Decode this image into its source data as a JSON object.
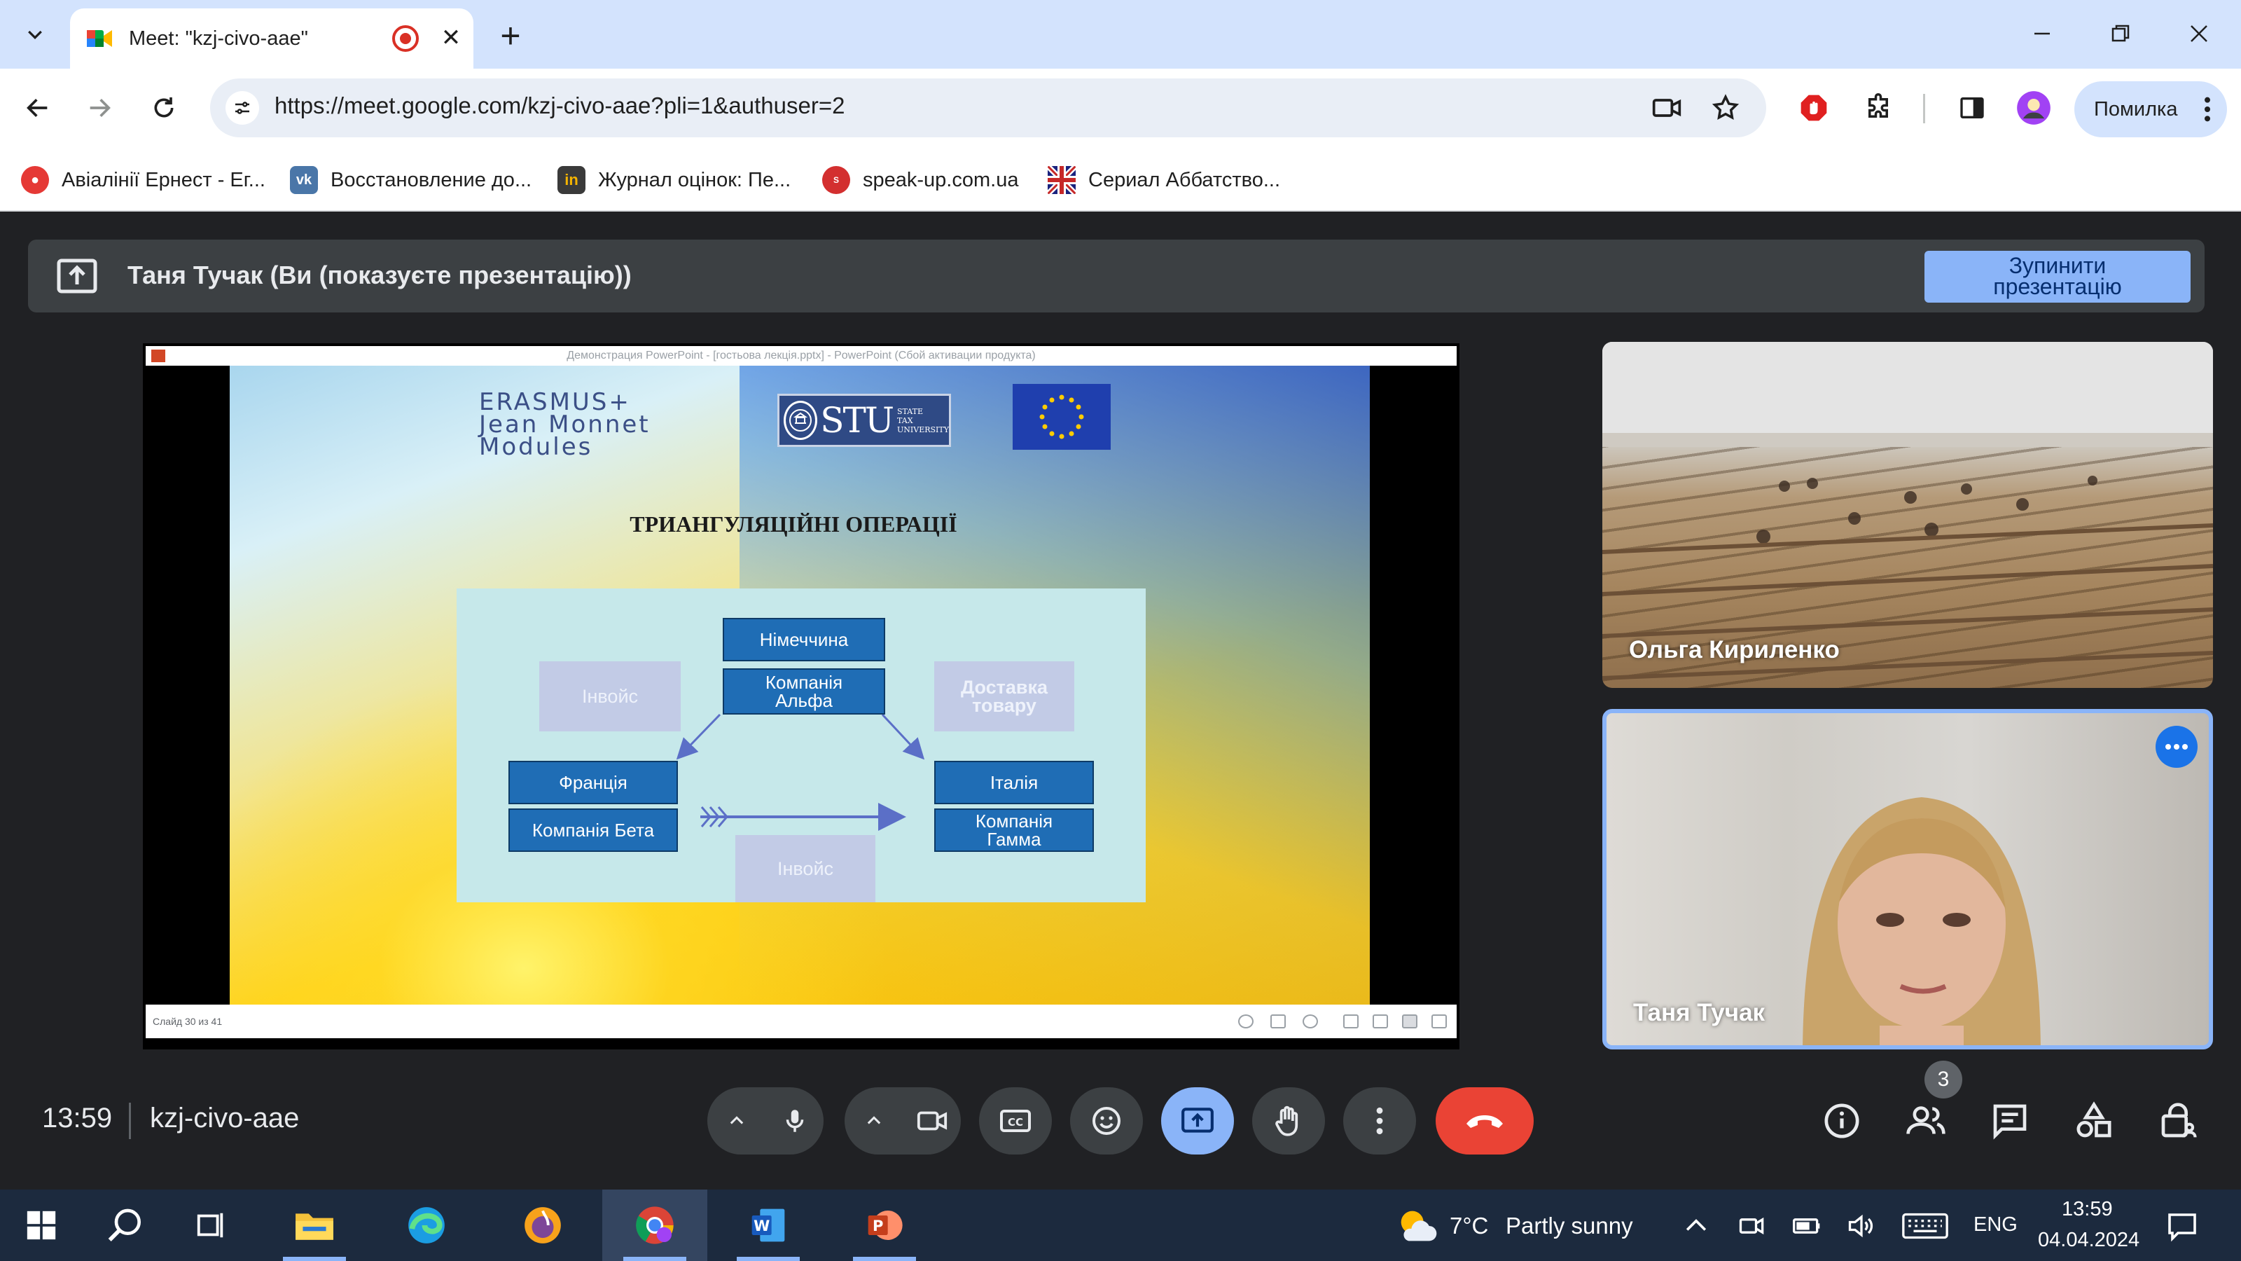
{
  "browser": {
    "tab_title": "Meet: \"kzj-civo-aae\"",
    "url": "https://meet.google.com/kzj-civo-aae?pli=1&authuser=2",
    "profile_label": "Помилка",
    "bookmarks": [
      {
        "label": "Авіалінії Ернест - Ег...",
        "icon": "ernest-icon",
        "color": "#e53935"
      },
      {
        "label": "Восстановление до...",
        "icon": "vk-icon",
        "color": "#4a76a8"
      },
      {
        "label": "Журнал оцінок: Пе...",
        "icon": "journal-icon",
        "color": "#3a3a3a"
      },
      {
        "label": "speak-up.com.ua",
        "icon": "speakup-icon",
        "color": "#d32f2f"
      },
      {
        "label": "Сериал Аббатство...",
        "icon": "uk-flag-icon",
        "color": "#1a237e"
      }
    ]
  },
  "meet": {
    "presenting_text": "Таня Тучак (Ви (показуєте презентацію))",
    "stop_presenting_line1": "Зупинити",
    "stop_presenting_line2": "презентацію",
    "clock": "13:59",
    "meeting_code": "kzj-civo-aae",
    "participant_count": "3",
    "participants": [
      {
        "name": "Ольга Кириленко"
      },
      {
        "name": "Таня Тучак"
      }
    ],
    "accent": "#8ab4f8",
    "hangup_color": "#ea4335"
  },
  "shared_screen": {
    "window_title": "Демонстрация PowerPoint - [гостьова лекція.pptx] - PowerPoint (Сбой активации продукта)",
    "slide_status": "Слайд 30 из 41",
    "slide": {
      "logo_erasmus_line1": "ERASMUS+",
      "logo_erasmus_line2": "Jean Monnet",
      "logo_erasmus_line3": "Modules",
      "logo_stu": "STU",
      "logo_stu_small1": "STATE",
      "logo_stu_small2": "TAX",
      "logo_stu_small3": "UNIVERSITY",
      "title": "ТРИАНГУЛЯЦІЙНІ ОПЕРАЦІЇ",
      "boxes": {
        "germany": "Німеччина",
        "company_alpha": "Компанія Альфа",
        "invoice_left": "Інвойс",
        "delivery": "Доставка товару",
        "france": "Франція",
        "company_beta": "Компанія Бета",
        "italy": "Італія",
        "company_gamma": "Компанія Гамма",
        "invoice_bottom": "Інвойс"
      }
    }
  },
  "taskbar": {
    "weather_temp": "7°C",
    "weather_text": "Partly sunny",
    "language": "ENG",
    "time": "13:59",
    "date": "04.04.2024"
  }
}
